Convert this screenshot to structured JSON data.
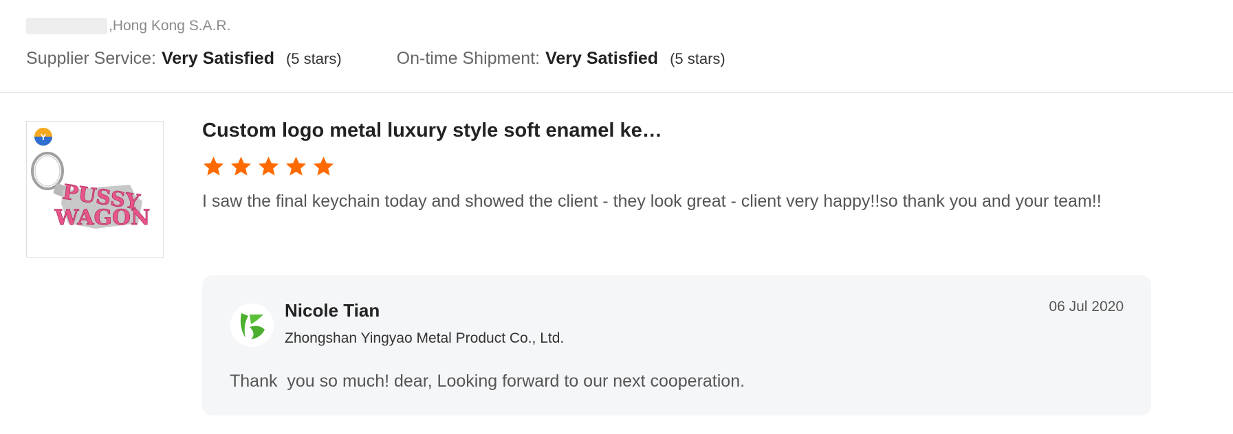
{
  "reviewer": {
    "location": ",Hong Kong S.A.R."
  },
  "ratings": {
    "supplier_service": {
      "label": "Supplier Service:",
      "value": "Very Satisfied",
      "stars_text": "(5 stars)"
    },
    "ontime_shipment": {
      "label": "On-time Shipment:",
      "value": "Very Satisfied",
      "stars_text": "(5 stars)"
    }
  },
  "review": {
    "product_title": "Custom logo metal luxury style soft enamel ke…",
    "rating": 5,
    "text": "I saw the final keychain today and showed the client - they look great - client very happy!!so thank you and your team!!",
    "thumbnail_text": [
      "PUSSY",
      "WAGON"
    ]
  },
  "reply": {
    "name": "Nicole Tian",
    "company": "Zhongshan Yingyao Metal Product Co., Ltd.",
    "date": "06 Jul 2020",
    "text": "Thank  you so much! dear, Looking forward to our next cooperation."
  },
  "colors": {
    "star": "#ff6a00",
    "reply_bg": "#f5f6f8",
    "keychain_pink": "#e8558a"
  }
}
